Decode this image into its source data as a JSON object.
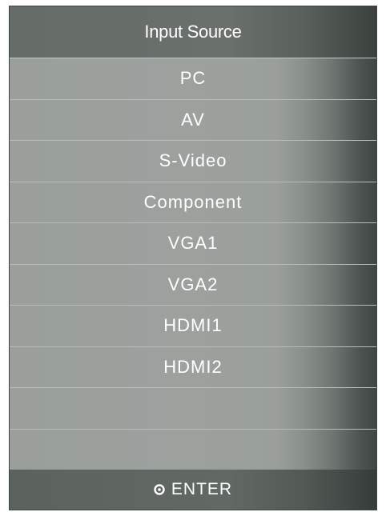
{
  "menu": {
    "title": "Input Source",
    "items": [
      {
        "label": "PC"
      },
      {
        "label": "AV"
      },
      {
        "label": "S-Video"
      },
      {
        "label": "Component"
      },
      {
        "label": "VGA1"
      },
      {
        "label": "VGA2"
      },
      {
        "label": "HDMI1"
      },
      {
        "label": "HDMI2"
      },
      {
        "label": ""
      },
      {
        "label": ""
      }
    ],
    "footer": {
      "icon": "enter-circle-icon",
      "label": "ENTER"
    }
  }
}
